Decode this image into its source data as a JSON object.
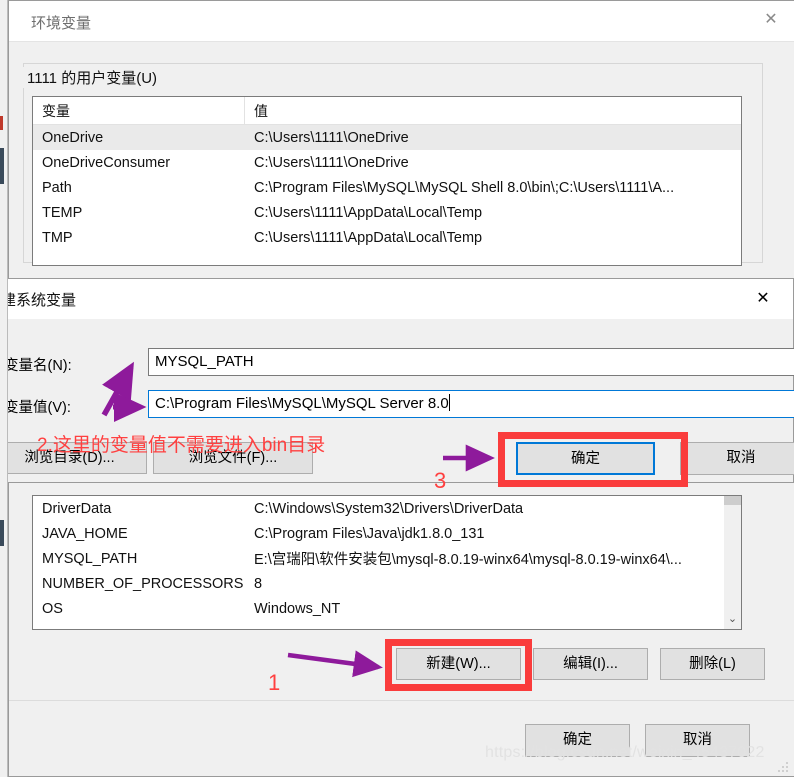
{
  "env_window": {
    "title": "环境变量",
    "close_icon": "✕",
    "group_label": "1111 的用户变量(U)",
    "user_table": {
      "columns": [
        "变量",
        "值"
      ],
      "rows": [
        {
          "name": "OneDrive",
          "value": "C:\\Users\\1111\\OneDrive",
          "selected": true
        },
        {
          "name": "OneDriveConsumer",
          "value": "C:\\Users\\1111\\OneDrive",
          "selected": false
        },
        {
          "name": "Path",
          "value": "C:\\Program Files\\MySQL\\MySQL Shell 8.0\\bin\\;C:\\Users\\1111\\A...",
          "selected": false
        },
        {
          "name": "TEMP",
          "value": "C:\\Users\\1111\\AppData\\Local\\Temp",
          "selected": false
        },
        {
          "name": "TMP",
          "value": "C:\\Users\\1111\\AppData\\Local\\Temp",
          "selected": false
        }
      ]
    },
    "system_table": {
      "rows": [
        {
          "name": "DriverData",
          "value": "C:\\Windows\\System32\\Drivers\\DriverData"
        },
        {
          "name": "JAVA_HOME",
          "value": "C:\\Program Files\\Java\\jdk1.8.0_131"
        },
        {
          "name": "MYSQL_PATH",
          "value": "E:\\宫瑞阳\\软件安装包\\mysql-8.0.19-winx64\\mysql-8.0.19-winx64\\..."
        },
        {
          "name": "NUMBER_OF_PROCESSORS",
          "value": "8"
        },
        {
          "name": "OS",
          "value": "Windows_NT"
        }
      ]
    },
    "buttons": {
      "new": "新建(W)...",
      "edit": "编辑(I)...",
      "delete": "删除(L)",
      "ok": "确定",
      "cancel": "取消"
    },
    "scrollbar": {
      "down_arrow_icon": "chevron-down-icon",
      "glyph": "⌄"
    }
  },
  "new_variable_dialog": {
    "title": "建系统变量",
    "close_icon": "✕",
    "name_label": "变量名(N):",
    "name_value": "MYSQL_PATH",
    "value_label": "变量值(V):",
    "value_value": "C:\\Program Files\\MySQL\\MySQL Server 8.0",
    "buttons": {
      "browse_dir": "浏览目录(D)...",
      "browse_file": "浏览文件(F)...",
      "ok": "确定",
      "cancel": "取消"
    }
  },
  "annotations": {
    "note_2": "2.这里的变量值不需要进入bin目录",
    "number_1": "1",
    "number_3": "3",
    "highlight_color": "#fa3c3c",
    "arrow_color": "#8e1a9b",
    "note_color": "#ff4040"
  },
  "watermark": {
    "text": "https://blog.csdn.net/weixin_45437022"
  }
}
